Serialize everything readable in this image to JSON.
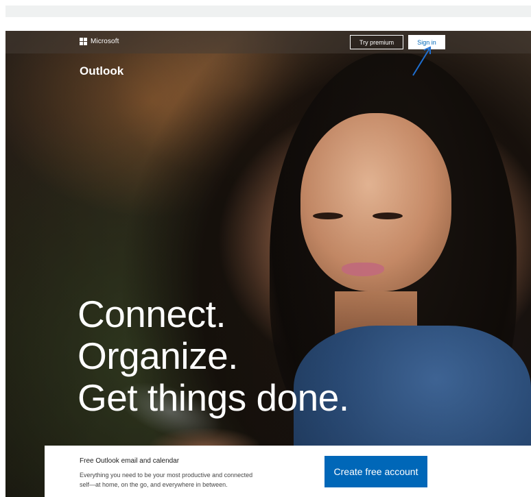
{
  "header": {
    "brand": "Microsoft",
    "try_premium_label": "Try premium",
    "sign_in_label": "Sign in"
  },
  "hero": {
    "product_title": "Outlook",
    "headline": [
      "Connect.",
      "Organize.",
      "Get things done."
    ]
  },
  "card": {
    "title": "Free Outlook email and calendar",
    "body_line1": "Everything you need to be your most productive and connected",
    "body_line2": "self—at home, on the go, and everywhere in between.",
    "cta_label": "Create free account"
  },
  "colors": {
    "brand_blue": "#0067b8",
    "annotation_arrow": "#1f6fd1"
  }
}
